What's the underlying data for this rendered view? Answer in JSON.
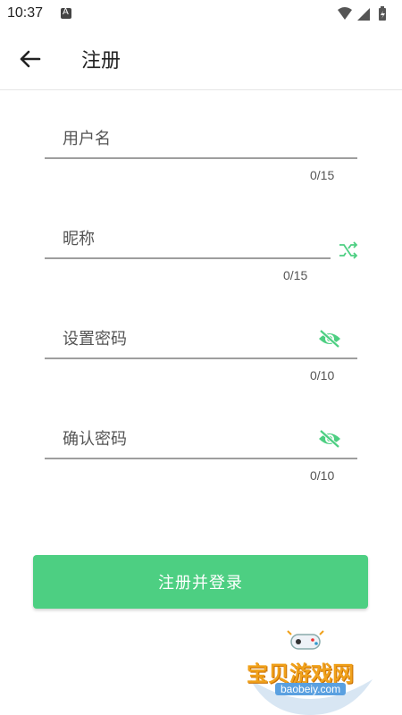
{
  "status_bar": {
    "time": "10:37"
  },
  "header": {
    "title": "注册"
  },
  "form": {
    "username": {
      "placeholder": "用户名",
      "counter": "0/15"
    },
    "nickname": {
      "placeholder": "昵称",
      "counter": "0/15"
    },
    "password": {
      "placeholder": "设置密码",
      "counter": "0/10"
    },
    "confirm_password": {
      "placeholder": "确认密码",
      "counter": "0/10"
    }
  },
  "submit_button": {
    "label": "注册并登录"
  },
  "watermark": {
    "text": "宝贝游戏网",
    "url": "baobeiy.com"
  },
  "colors": {
    "accent": "#4dcf82",
    "underline": "#9e9e9e"
  },
  "icons": [
    "back-arrow-icon",
    "shuffle-icon",
    "eye-off-icon",
    "wifi-icon",
    "signal-icon",
    "battery-icon"
  ]
}
